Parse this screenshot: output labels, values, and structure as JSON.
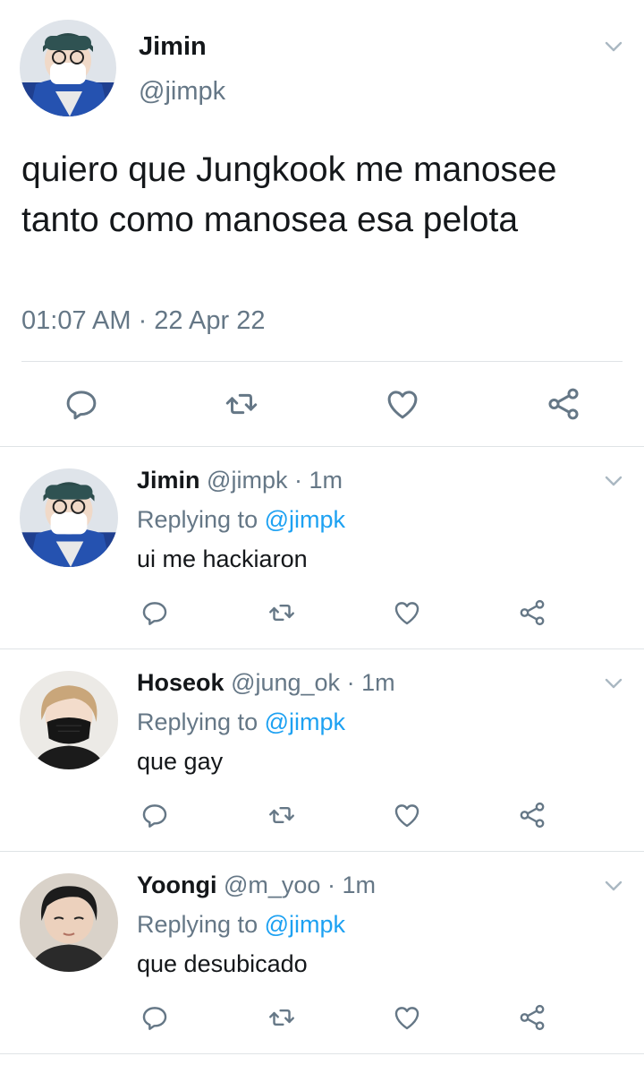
{
  "main_tweet": {
    "name": "Jimin",
    "handle": "@jimpk",
    "text": "quiero que Jungkook me manosee tanto como manosea esa pelota",
    "timestamp": "01:07 AM · 22 Apr 22",
    "actions": [
      "reply-icon",
      "retweet-icon",
      "like-icon",
      "share-icon"
    ]
  },
  "replies": [
    {
      "name": "Jimin",
      "handle": "@jimpk",
      "time": "1m",
      "replying_prefix": "Replying to",
      "replying_to": "@jimpk",
      "text": "ui me hackiaron"
    },
    {
      "name": "Hoseok",
      "handle": "@jung_ok",
      "time": "1m",
      "replying_prefix": "Replying to",
      "replying_to": "@jimpk",
      "text": "que gay"
    },
    {
      "name": "Yoongi",
      "handle": "@m_yoo",
      "time": "1m",
      "replying_prefix": "Replying to",
      "replying_to": "@jimpk",
      "text": "que desubicado"
    }
  ],
  "separator": "·",
  "colors": {
    "text": "#14171a",
    "secondary": "#657786",
    "link": "#1da1f2",
    "icon": "#657786",
    "divider": "#dfe3e6"
  }
}
